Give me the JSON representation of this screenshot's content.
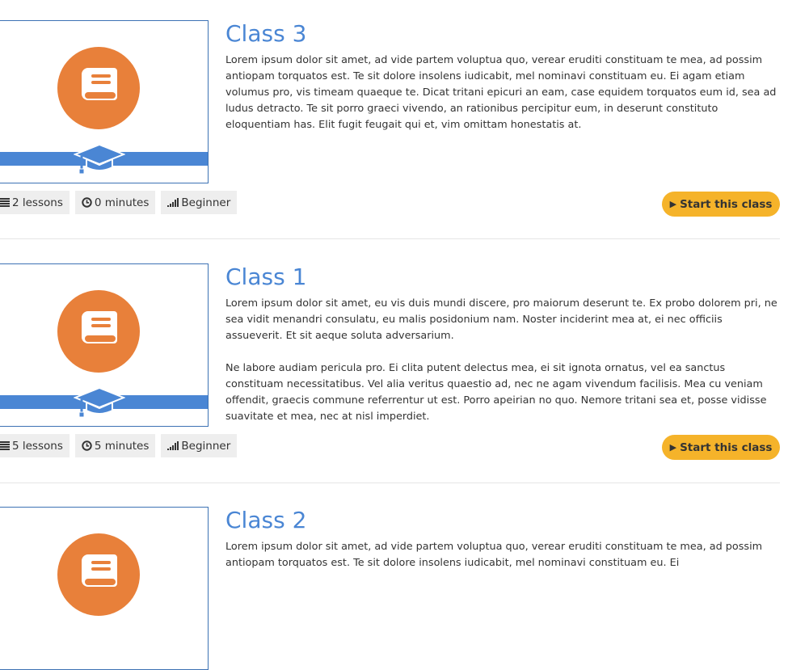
{
  "classes": [
    {
      "title": "Class 3",
      "paragraphs": [
        "Lorem ipsum dolor sit amet, ad vide partem voluptua quo, verear eruditi constituam te mea, ad possim antiopam torquatos est. Te sit dolore insolens iudicabit, mel nominavi constituam eu. Ei agam etiam volumus pro, vis timeam quaeque te. Dicat tritani epicuri an eam, case equidem torquatos eum id, sea ad ludus detracto. Te sit porro graeci vivendo, an rationibus percipitur eum, in deserunt constituto eloquentiam has. Elit fugit feugait qui et, vim omittam honestatis at."
      ],
      "lessons": "2 lessons",
      "minutes": "0 minutes",
      "level": "Beginner",
      "button": "Start this class"
    },
    {
      "title": "Class 1",
      "paragraphs": [
        "Lorem ipsum dolor sit amet, eu vis duis mundi discere, pro maiorum deserunt te. Ex probo dolorem pri, ne sea vidit menandri consulatu, eu malis posidonium nam. Noster inciderint mea at, ei nec officiis assueverit. Et sit aeque soluta adversarium.",
        "Ne labore audiam pericula pro. Ei clita putent delectus mea, ei sit ignota ornatus, vel ea sanctus constituam necessitatibus. Vel alia veritus quaestio ad, nec ne agam vivendum facilisis. Mea cu veniam offendit, graecis commune referrentur ut est. Porro apeirian no quo. Nemore tritani sea et, posse vidisse suavitate et mea, nec at nisl imperdiet."
      ],
      "lessons": "5 lessons",
      "minutes": "5 minutes",
      "level": "Beginner",
      "button": "Start this class"
    },
    {
      "title": "Class 2",
      "paragraphs": [
        "Lorem ipsum dolor sit amet, ad vide partem voluptua quo, verear eruditi constituam te mea, ad possim antiopam torquatos est. Te sit dolore insolens iudicabit, mel nominavi constituam eu. Ei"
      ]
    }
  ],
  "icons": {
    "lessons": "list-icon",
    "minutes": "clock-icon",
    "level": "signal-bars-icon",
    "button": "play-icon",
    "thumbnail": "book-icon",
    "thumbnail_cap": "graduation-cap-icon"
  },
  "colors": {
    "title": "#4a86d4",
    "thumbnail_circle": "#e8803a",
    "thumbnail_band": "#4a86d4",
    "button": "#f5b32a",
    "chip": "#eeeeee"
  }
}
